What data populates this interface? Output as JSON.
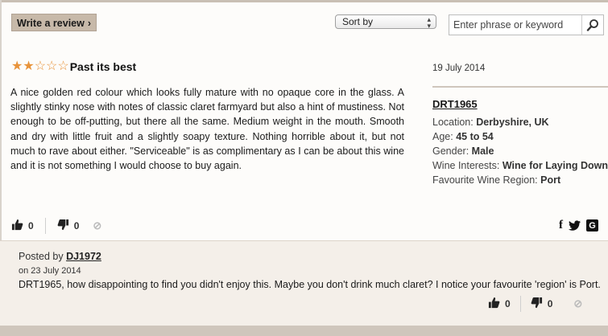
{
  "toolbar": {
    "write_review": "Write a review",
    "sort_by": "Sort by",
    "search_placeholder": "Enter phrase or keyword"
  },
  "review": {
    "rating": 2,
    "rating_max": 5,
    "title": "Past its best",
    "body": "A nice golden red colour which looks fully mature with no opaque core in the glass. A slightly stinky nose with notes of classic claret farmyard but also a hint of mustiness. Not enough to be off-putting, but there all the same. Medium weight in the mouth. Smooth and dry with little fruit and a slightly soapy texture. Nothing horrible about it, but not much to rave about either. \"Serviceable\" is as complimentary as I can be about this wine and it is not something I would choose to buy again.",
    "date": "19 July 2014",
    "likes": "0",
    "dislikes": "0"
  },
  "reviewer": {
    "name": "DRT1965",
    "location_label": "Location:",
    "location": "Derbyshire, UK",
    "age_label": "Age:",
    "age": "45 to 54",
    "gender_label": "Gender:",
    "gender": "Male",
    "interests_label": "Wine Interests:",
    "interests": "Wine for Laying Down",
    "region_label": "Favourite Wine Region:",
    "region": "Port"
  },
  "comment": {
    "posted_by_label": "Posted by",
    "author": "DJ1972",
    "date": "on 23 July 2014",
    "text": "DRT1965, how disappointing to find you didn't enjoy this. Maybe you don't drink much claret? I notice your favourite 'region' is Port.",
    "likes": "0",
    "dislikes": "0"
  }
}
